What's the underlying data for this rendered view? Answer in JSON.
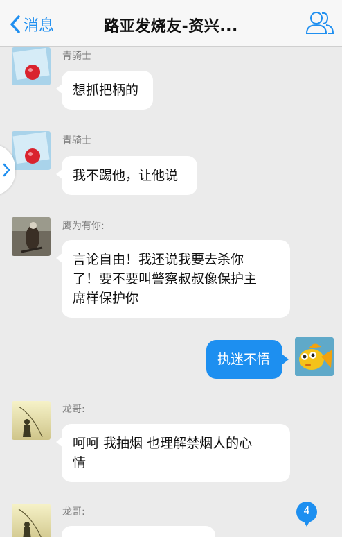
{
  "nav": {
    "back_label": "消息",
    "title": "路亚发烧友-资兴...",
    "icons": [
      "chevron-left-icon",
      "group-members-icon"
    ]
  },
  "messages": [
    {
      "sender": "青骑士",
      "text": "想抓把柄的",
      "side": "left",
      "avatar": "red-ball-avatar"
    },
    {
      "sender": "青骑士",
      "text": "我不踢他，让他说",
      "side": "left",
      "avatar": "red-ball-avatar"
    },
    {
      "sender": "鹰为有你:",
      "lines": [
        "言论自由！我还说我要去杀你",
        "了！要不要叫警察叔叔像保护主",
        "席样保护你"
      ],
      "side": "left",
      "avatar": "eagle-avatar"
    },
    {
      "sender": "",
      "text": "执迷不悟",
      "side": "right",
      "avatar": "goldfish-avatar"
    },
    {
      "sender": "龙哥:",
      "lines": [
        "呵呵  我抽烟 也理解禁烟人的心",
        "情"
      ],
      "side": "left",
      "avatar": "fisherman-avatar"
    },
    {
      "sender": "龙哥:",
      "text": "",
      "side": "left",
      "avatar": "fisherman-avatar"
    }
  ],
  "unread_badge": "4",
  "colors": {
    "accent": "#1d8ff0",
    "background": "#ebebeb"
  }
}
